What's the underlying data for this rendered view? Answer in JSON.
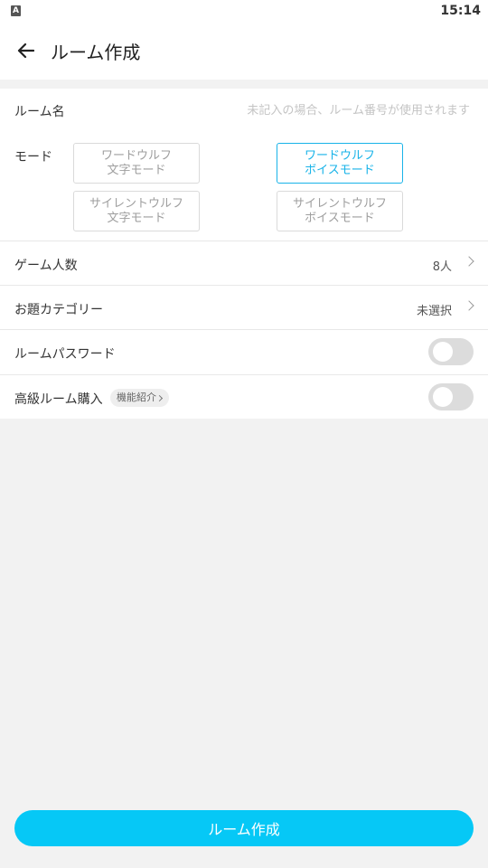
{
  "status_bar": {
    "time": "15:14",
    "app_icon": "A"
  },
  "header": {
    "title": "ルーム作成",
    "back_icon": "arrow-left-icon"
  },
  "form": {
    "room_name": {
      "label": "ルーム名",
      "value": "",
      "placeholder": "未記入の場合、ルーム番号が使用されます"
    },
    "mode": {
      "label": "モード",
      "options": [
        {
          "line1": "ワードウルフ",
          "line2": "文字モード",
          "selected": false
        },
        {
          "line1": "ワードウルフ",
          "line2": "ボイスモード",
          "selected": true
        },
        {
          "line1": "サイレントウルフ",
          "line2": "文字モード",
          "selected": false
        },
        {
          "line1": "サイレントウルフ",
          "line2": "ボイスモード",
          "selected": false
        }
      ]
    },
    "player_count": {
      "label": "ゲーム人数",
      "value": "8人"
    },
    "topic_category": {
      "label": "お題カテゴリー",
      "value": "未選択"
    },
    "room_password": {
      "label": "ルームパスワード",
      "enabled": false
    },
    "premium_room": {
      "label": "高級ルーム購入",
      "badge": "機能紹介",
      "enabled": false
    }
  },
  "footer": {
    "create_button_label": "ルーム作成"
  },
  "colors": {
    "accent": "#18b3e8",
    "primary_button": "#06c8f6",
    "toggle_off": "#dcdcdc"
  }
}
